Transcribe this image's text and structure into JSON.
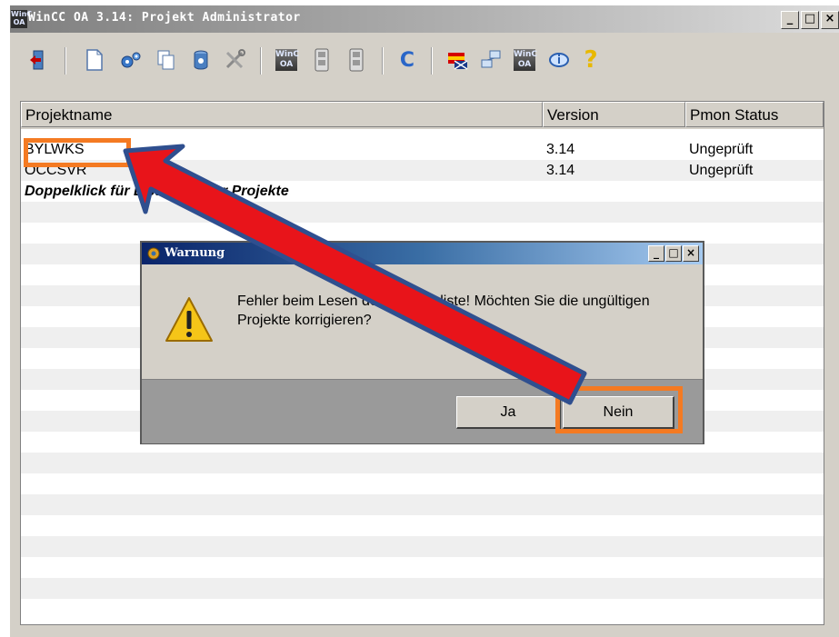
{
  "window": {
    "title": "WinCC OA 3.14: Projekt Administrator",
    "app_icon_text": "WinC OA",
    "btn_minimize": "_",
    "btn_maximize": "□",
    "btn_close": "×"
  },
  "toolbar": {
    "items": [
      {
        "name": "exit-icon"
      },
      {
        "name": "new-project-icon"
      },
      {
        "name": "settings-cogs-icon"
      },
      {
        "name": "copy-project-icon"
      },
      {
        "name": "database-icon"
      },
      {
        "name": "tools-icon"
      },
      {
        "name": "winccoa-icon"
      },
      {
        "name": "server-icon"
      },
      {
        "name": "server-alt-icon"
      },
      {
        "name": "refresh-icon"
      },
      {
        "name": "language-icon"
      },
      {
        "name": "network-icon"
      },
      {
        "name": "winccoa-info-icon"
      },
      {
        "name": "info-icon"
      },
      {
        "name": "help-icon"
      }
    ],
    "winoa_text": "WinC OA",
    "refresh_glyph": "C",
    "help_glyph": "?"
  },
  "table": {
    "headers": [
      "Projektname",
      "Version",
      "Pmon Status"
    ],
    "rows": [
      {
        "name": "BYLWKS",
        "version": "3.14",
        "status": "Ungeprüft"
      },
      {
        "name": "OCCSVR",
        "version": "3.14",
        "status": "Ungeprüft"
      }
    ],
    "hint": "Doppelklick für Liste weiterer Projekte"
  },
  "dialog": {
    "title": "Warnung",
    "message": "Fehler beim Lesen der Projekteliste! Möchten Sie die ungültigen Projekte korrigieren?",
    "btn_yes": "Ja",
    "btn_no": "Nein",
    "btn_minimize": "_",
    "btn_maximize": "□",
    "btn_close": "×"
  },
  "colors": {
    "highlight": "#f47a22",
    "arrow_fill": "#e8141a",
    "arrow_outline": "#2f4f8f"
  }
}
